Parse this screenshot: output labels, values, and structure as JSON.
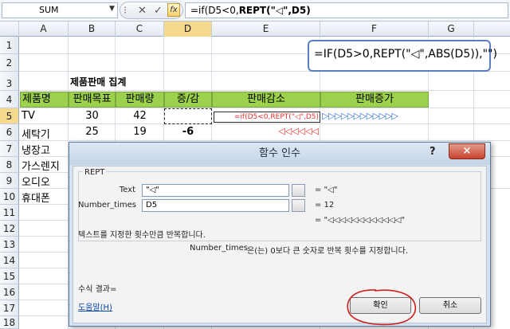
{
  "formula_bar": {
    "name_box": "SUM",
    "formula_plain": "=if(D5<0,",
    "formula_bold": "REPT(\"◁\",D5)"
  },
  "columns": [
    "A",
    "B",
    "C",
    "D",
    "E",
    "F",
    "G"
  ],
  "rows": [
    "1",
    "2",
    "3",
    "4",
    "5",
    "6",
    "7",
    "8",
    "9",
    "10",
    "11",
    "12",
    "13",
    "14",
    "15",
    "16",
    "17",
    "18"
  ],
  "sheet": {
    "title": "제품판매 집계",
    "headers": [
      "제품명",
      "판매목표",
      "판매량",
      "증/감",
      "판매감소",
      "판매증가"
    ],
    "r5": {
      "a": "TV",
      "b": "30",
      "c": "42",
      "e": "=if(D5<0,REPT(\"◁\",D5)",
      "f": "▷▷▷▷▷▷▷▷▷▷▷▷"
    },
    "r6": {
      "a": "세탁기",
      "b": "25",
      "c": "19",
      "d": "-6",
      "e": "◁◁◁◁◁◁"
    },
    "products": [
      "냉장고",
      "가스렌지",
      "오디오",
      "휴대폰"
    ]
  },
  "note": "=IF(D5>0,REPT(\"◁\",ABS(D5)),\"\")",
  "dialog": {
    "title": "함수 인수",
    "help": "?",
    "close": "×",
    "function": "REPT",
    "text_label": "Text",
    "text_value": "\"◁\"",
    "text_result": "= \"◁\"",
    "times_label": "Number_times",
    "times_value": "D5",
    "times_result": "= 12",
    "result_preview": "= \"◁◁◁◁◁◁◁◁◁◁◁◁\"",
    "description": "텍스트를 지정한 횟수만큼 반복합니다.",
    "arg_name": "Number_times",
    "arg_desc": "은(는) 0보다 큰 숫자로 반복 횟수를 지정합니다.",
    "formula_result": "수식 결과=",
    "help_link": "도움말(H)",
    "ok": "확인",
    "cancel": "취소"
  },
  "colors": {
    "green": "#9bd14c",
    "red_text": "#e0302a",
    "arrow_blue": "#2e6fd6",
    "annotation": "#cc1f1f"
  }
}
